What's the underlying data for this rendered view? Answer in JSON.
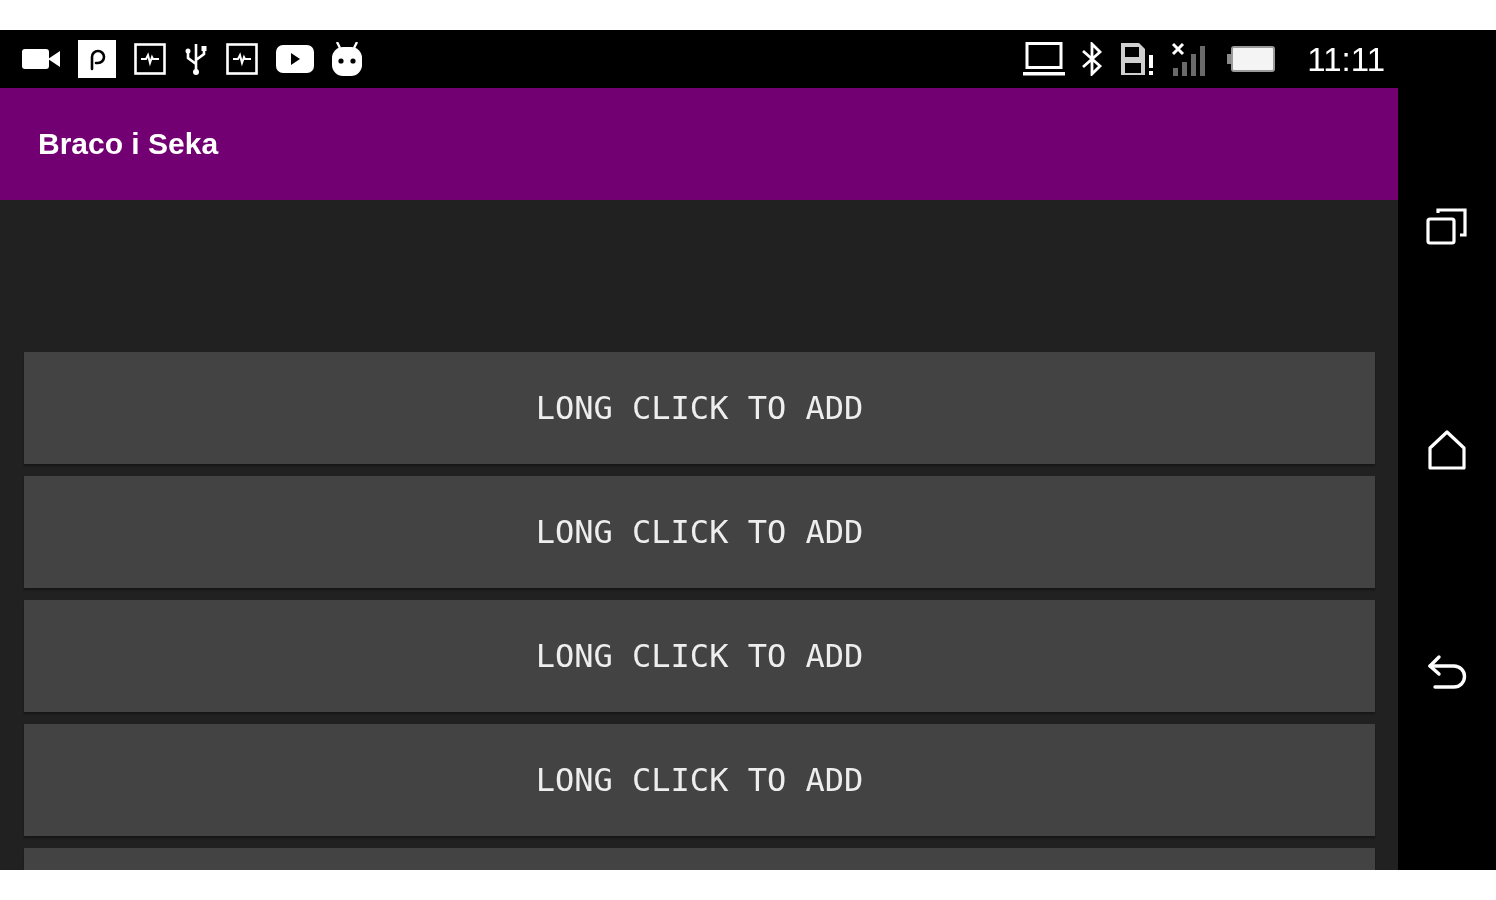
{
  "status_bar": {
    "time": "11:11"
  },
  "app_bar": {
    "title": "Braco i Seka"
  },
  "list": [
    {
      "kind": "button",
      "label": "LONG CLICK TO ADD"
    },
    {
      "kind": "button",
      "label": "LONG CLICK TO ADD"
    },
    {
      "kind": "button",
      "label": "LONG CLICK TO ADD"
    },
    {
      "kind": "button",
      "label": "LONG CLICK TO ADD"
    },
    {
      "kind": "partial"
    }
  ]
}
